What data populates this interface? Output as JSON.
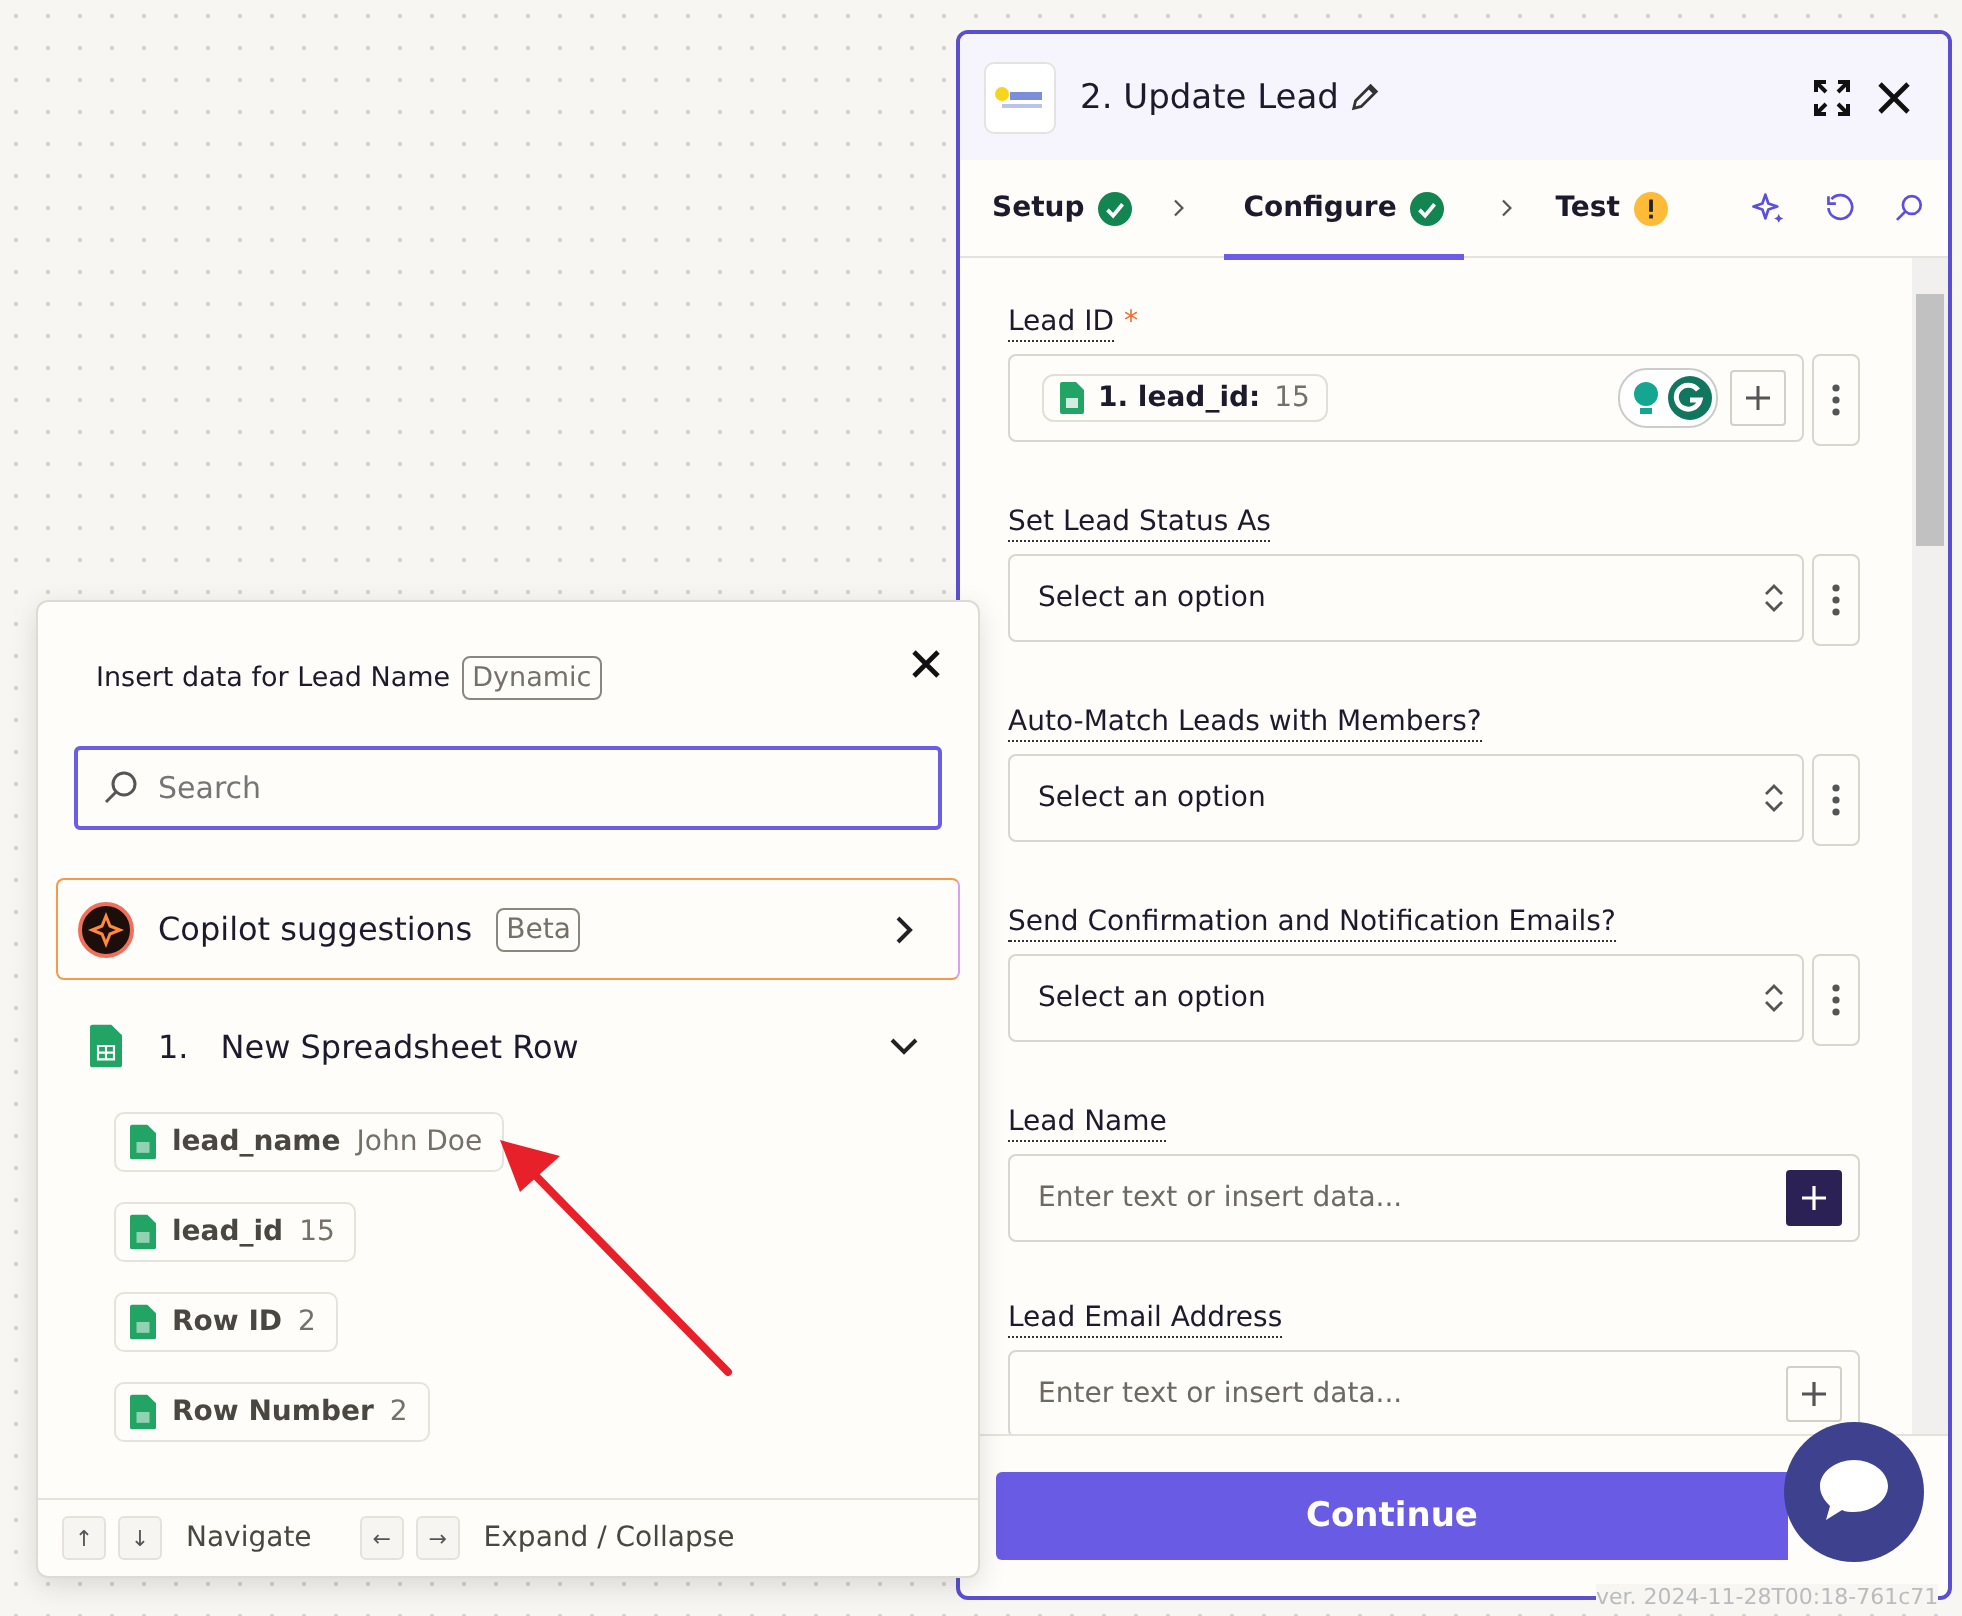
{
  "step_panel": {
    "title": "2. Update Lead",
    "tabs": [
      {
        "label": "Setup",
        "complete": true,
        "selected": false
      },
      {
        "label": "Configure",
        "complete": true,
        "selected": true
      },
      {
        "label": "Test",
        "complete": false,
        "selected": false
      }
    ],
    "fields": [
      {
        "label": "Lead ID",
        "required_mark": "*",
        "kind": "token",
        "token_label": "1. lead_id:",
        "token_value": "15"
      },
      {
        "label": "Set Lead Status As",
        "kind": "select",
        "placeholder": "Select an option"
      },
      {
        "label": "Auto-Match Leads with Members?",
        "kind": "select",
        "placeholder": "Select an option"
      },
      {
        "label": "Send Confirmation and Notification Emails?",
        "kind": "select",
        "placeholder": "Select an option"
      },
      {
        "label": "Lead Name",
        "kind": "text",
        "placeholder": "Enter text or insert data...",
        "active": true
      },
      {
        "label": "Lead Email Address",
        "kind": "text",
        "placeholder": "Enter text or insert data...",
        "active": false
      }
    ],
    "continue_button": "Continue"
  },
  "insert_popup": {
    "title": "Insert data for Lead Name",
    "badge": "Dynamic",
    "search": {
      "placeholder": "Search"
    },
    "copilot": {
      "label": "Copilot suggestions",
      "badge": "Beta"
    },
    "section": {
      "number": "1.",
      "title": "New Spreadsheet Row",
      "expanded": true
    },
    "items": [
      {
        "name": "lead_name",
        "value": "John Doe"
      },
      {
        "name": "lead_id",
        "value": "15"
      },
      {
        "name": "Row ID",
        "value": "2"
      },
      {
        "name": "Row Number",
        "value": "2"
      }
    ],
    "footer": [
      {
        "keys": [
          "↑",
          "↓"
        ],
        "label": "Navigate"
      },
      {
        "keys": [
          "←",
          "→"
        ],
        "label": "Expand / Collapse"
      }
    ]
  },
  "version": "ver. 2024-11-28T00:18-761c71"
}
